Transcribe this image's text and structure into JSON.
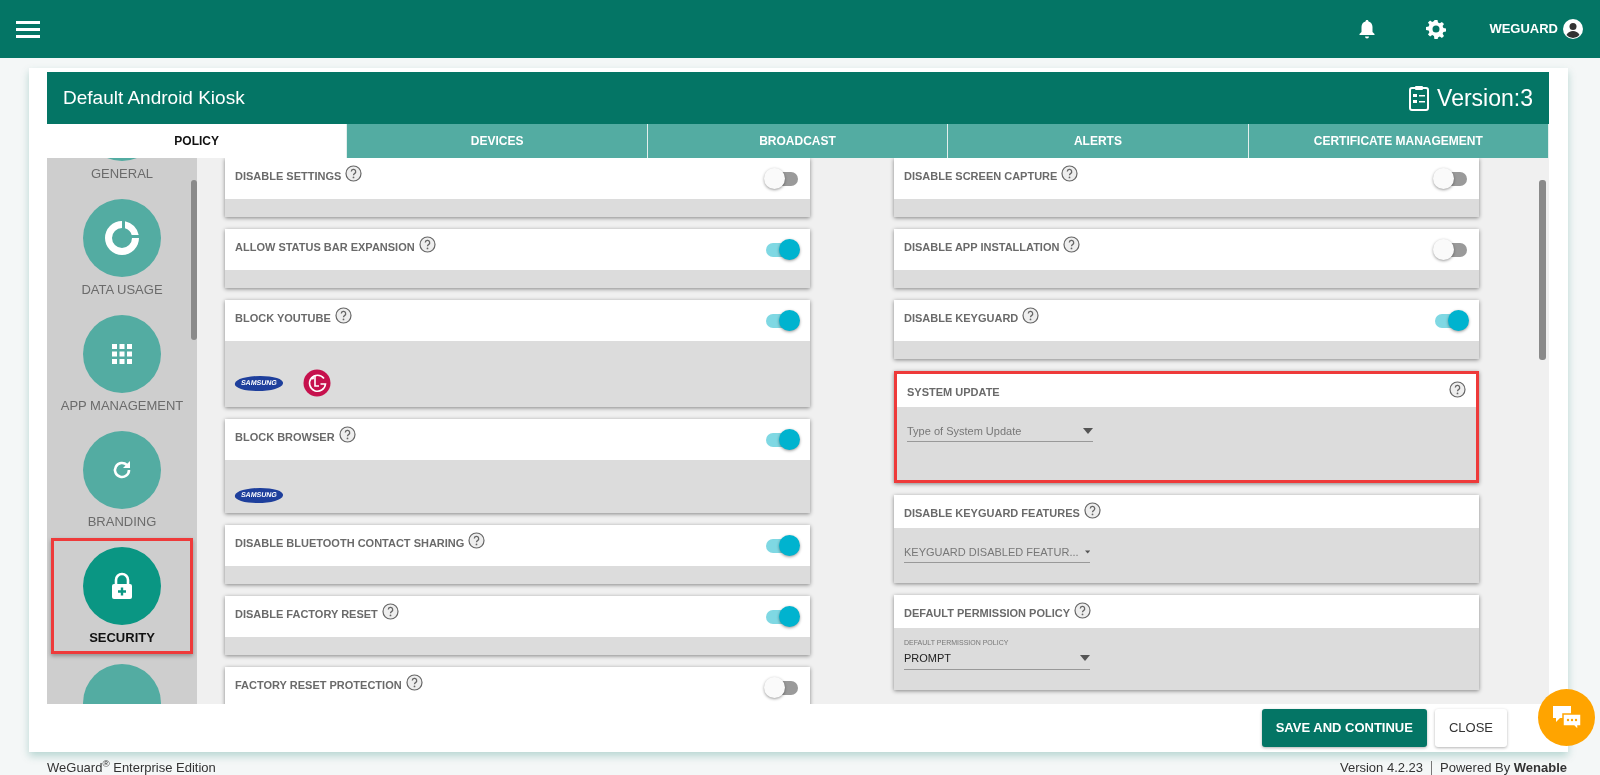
{
  "header": {
    "user": "WEGUARD"
  },
  "panel": {
    "title": "Default Android Kiosk",
    "version": "Version:3"
  },
  "tabs": [
    {
      "label": "POLICY",
      "selected": true
    },
    {
      "label": "DEVICES",
      "selected": false
    },
    {
      "label": "BROADCAST",
      "selected": false
    },
    {
      "label": "ALERTS",
      "selected": false
    },
    {
      "label": "CERTIFICATE MANAGEMENT",
      "selected": false
    }
  ],
  "sidebar": {
    "items": [
      {
        "label": "GENERAL",
        "selected": false,
        "highlighted": false
      },
      {
        "label": "DATA USAGE",
        "selected": false,
        "highlighted": false
      },
      {
        "label": "APP MANAGEMENT",
        "selected": false,
        "highlighted": false
      },
      {
        "label": "BRANDING",
        "selected": false,
        "highlighted": false
      },
      {
        "label": "SECURITY",
        "selected": true,
        "highlighted": true
      }
    ]
  },
  "left_policies": [
    {
      "kind": "toggle",
      "label": "DISABLE SETTINGS",
      "on": false
    },
    {
      "kind": "toggle",
      "label": "ALLOW STATUS BAR EXPANSION",
      "on": true
    },
    {
      "kind": "toggle",
      "label": "BLOCK YOUTUBE",
      "on": true,
      "logos": [
        {
          "kind": "samsung",
          "text": "SAMSUNG"
        },
        {
          "kind": "lg"
        }
      ]
    },
    {
      "kind": "toggle",
      "label": "BLOCK BROWSER",
      "on": true,
      "logos": [
        {
          "kind": "samsung",
          "text": "SAMSUNG"
        }
      ]
    },
    {
      "kind": "toggle",
      "label": "DISABLE BLUETOOTH CONTACT SHARING",
      "on": true
    },
    {
      "kind": "toggle",
      "label": "DISABLE FACTORY RESET",
      "on": true
    },
    {
      "kind": "toggle",
      "label": "FACTORY RESET PROTECTION",
      "on": false
    }
  ],
  "right_policies": [
    {
      "kind": "toggle",
      "label": "DISABLE SCREEN CAPTURE",
      "on": false
    },
    {
      "kind": "toggle",
      "label": "DISABLE APP INSTALLATION",
      "on": false
    },
    {
      "kind": "toggle",
      "label": "DISABLE KEYGUARD",
      "on": true
    },
    {
      "kind": "select",
      "label": "SYSTEM UPDATE",
      "help_right": true,
      "highlighted": true,
      "placeholder": "Type of System Update"
    },
    {
      "kind": "select",
      "label": "DISABLE KEYGUARD FEATURES",
      "placeholder": "KEYGUARD DISABLED FEATUR..."
    },
    {
      "kind": "select",
      "label": "DEFAULT PERMISSION POLICY",
      "field_label": "DEFAULT PERMISSION POLICY",
      "value": "PROMPT"
    }
  ],
  "buttons": [
    {
      "label": "SAVE AND CONTINUE",
      "kind": "primary"
    },
    {
      "label": "CLOSE",
      "kind": "secondary"
    }
  ],
  "footer": {
    "edition": "WeGuard$^{®}$ Enterprise Edition",
    "version": "Version 4.2.23",
    "powered": "Powered By **Wenable**"
  }
}
